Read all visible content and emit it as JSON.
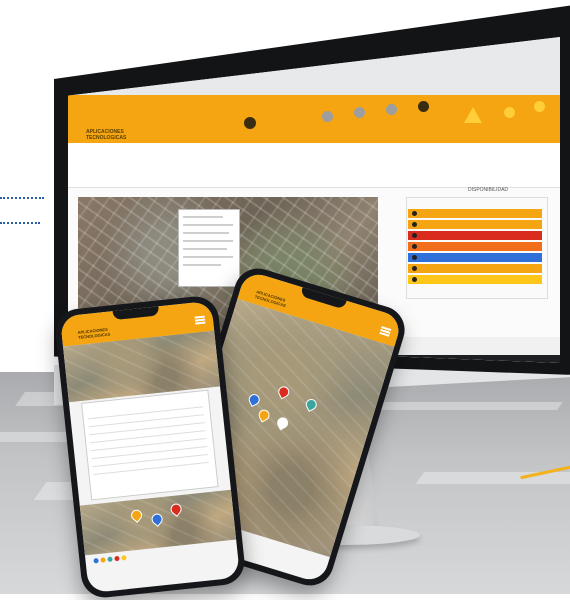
{
  "colors": {
    "brand": "#f5a511",
    "accent_dots": "#2a5fa8",
    "device": "#15171a",
    "floor": "#c2c4c6"
  },
  "monitor": {
    "app": {
      "logo_line1": "APLICACIONES",
      "logo_line2": "TECNOLOGICAS",
      "header_title": "",
      "map_title": "",
      "panel_title": "DISPONIBILIDAD",
      "rows": [
        {
          "label": "",
          "color": "#f5a511"
        },
        {
          "label": "",
          "color": "#f5a511"
        },
        {
          "label": "",
          "color": "#d92c1e"
        },
        {
          "label": "",
          "color": "#f06e1c"
        },
        {
          "label": "",
          "color": "#2f6fd8"
        },
        {
          "label": "",
          "color": "#f5a511"
        },
        {
          "label": "",
          "color": "#ffc61a"
        }
      ],
      "toolbar_icons": [
        "alert-icon",
        "message-icon",
        "sound-icon"
      ]
    }
  },
  "phone_right": {
    "logo_line1": "APLICACIONES",
    "logo_line2": "TECNOLOGICAS",
    "markers": [
      {
        "color": "#d92c1e"
      },
      {
        "color": "#2f6fd8"
      },
      {
        "color": "#3aa6a0"
      },
      {
        "color": "#f5a511"
      },
      {
        "color": "#ffffff"
      }
    ]
  },
  "phone_left": {
    "logo_line1": "APLICACIONES",
    "logo_line2": "TECNOLOGICAS"
  }
}
